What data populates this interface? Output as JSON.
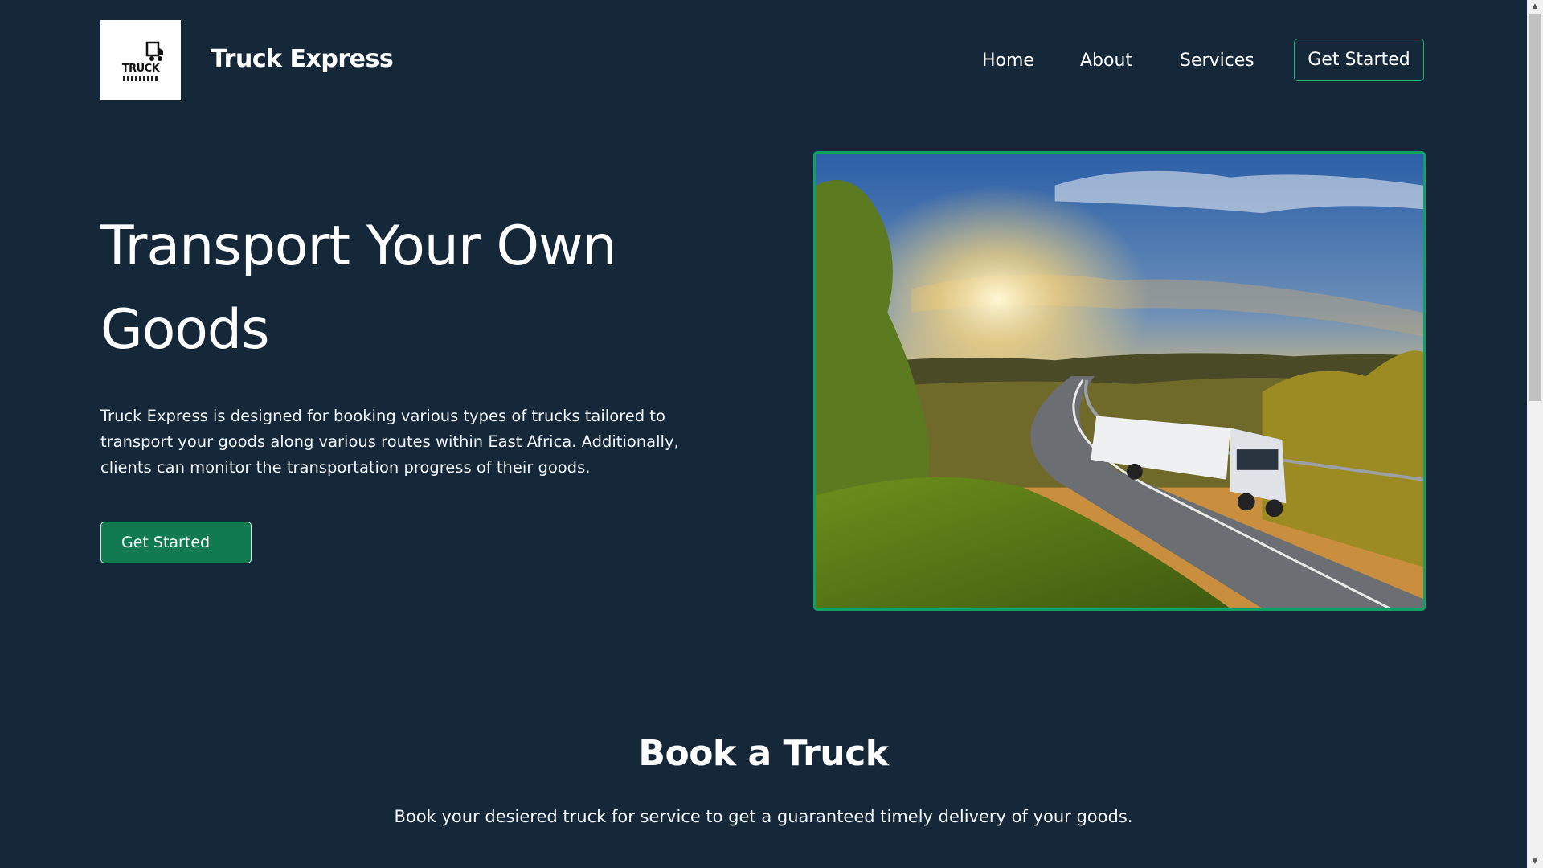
{
  "header": {
    "logo_text": "TRUCK",
    "brand": "Truck Express",
    "nav": {
      "home": "Home",
      "about": "About",
      "services": "Services",
      "cta": "Get Started"
    }
  },
  "hero": {
    "title": "Transport Your Own Goods",
    "description": "Truck Express is designed for booking various types of trucks tailored to transport your goods along various routes within East Africa. Additionally, clients can monitor the transportation progress of their goods.",
    "button": "Get Started",
    "image_icon": "truck-highway-sunset-photo"
  },
  "book_section": {
    "title": "Book a Truck",
    "subtitle": "Book your desiered truck for service to get a guaranteed timely delivery of your goods."
  },
  "colors": {
    "background": "#15283a",
    "accent": "#127a50",
    "accent_border": "#10a063"
  }
}
